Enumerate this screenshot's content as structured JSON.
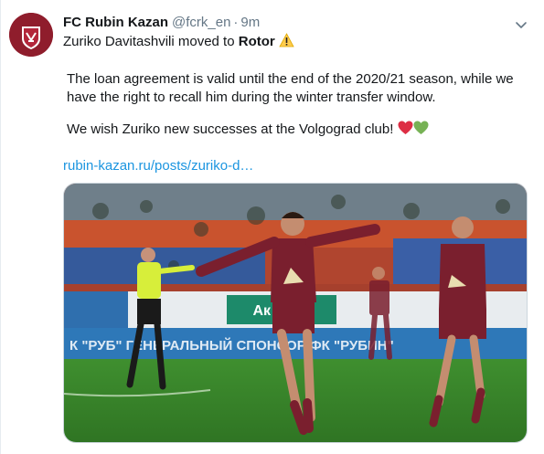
{
  "tweet": {
    "author_name": "FC Rubin Kazan",
    "author_handle": "@fcrk_en",
    "separator": "·",
    "timestamp": "9m",
    "line1_prefix": "Zuriko Davitashvili moved to ",
    "line1_bold": "Rotor",
    "paragraph2": "The loan agreement is valid until the end of the 2020/21 season, while we have the right to recall him during the winter transfer window.",
    "paragraph3": "We wish Zuriko new successes at the Volgograd club!",
    "link_text": "rubin-kazan.ru/posts/zuriko-d…"
  },
  "media": {
    "banner_text": "К \"РУБ\"   ГЕНЕРАЛЬНЫЙ СПОНСОР ФК \"РУБИН\"",
    "board_text": "Ак Барс"
  },
  "icons": {
    "avatar": "rubin-kazan-logo-icon",
    "caret": "chevron-down-icon",
    "warning": "warning-icon",
    "hearts": [
      "red-heart-icon",
      "green-heart-icon"
    ]
  },
  "colors": {
    "link": "#1b95e0",
    "secondary_text": "#657786",
    "club_red": "#8f1d2c",
    "kit": "#7a1f2e"
  }
}
